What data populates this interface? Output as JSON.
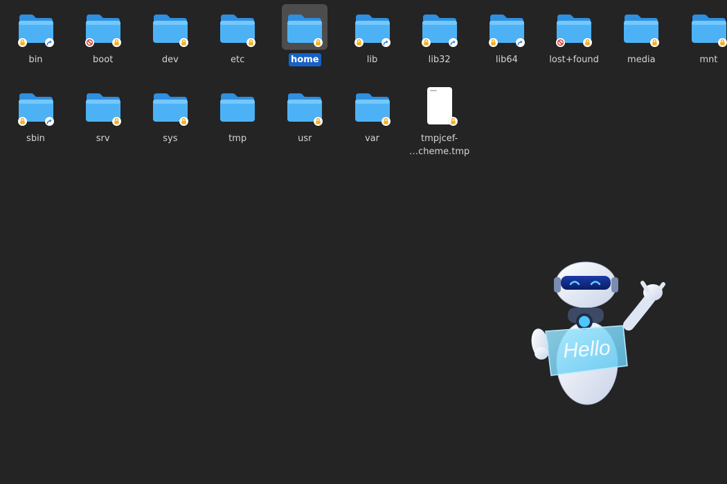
{
  "desktop": {
    "background": "#242424",
    "accent_selected": "#1761c7",
    "items": [
      {
        "label": "bin",
        "kind": "folder",
        "badges": [
          "lock",
          "symlink"
        ],
        "selected": false
      },
      {
        "label": "boot",
        "kind": "folder",
        "badges": [
          "no-access",
          "lock"
        ],
        "selected": false
      },
      {
        "label": "dev",
        "kind": "folder",
        "badges": [
          "lock"
        ],
        "selected": false
      },
      {
        "label": "etc",
        "kind": "folder",
        "badges": [
          "lock"
        ],
        "selected": false
      },
      {
        "label": "home",
        "kind": "folder",
        "badges": [
          "lock"
        ],
        "selected": true
      },
      {
        "label": "lib",
        "kind": "folder",
        "badges": [
          "lock",
          "symlink"
        ],
        "selected": false
      },
      {
        "label": "lib32",
        "kind": "folder",
        "badges": [
          "lock",
          "symlink"
        ],
        "selected": false
      },
      {
        "label": "lib64",
        "kind": "folder",
        "badges": [
          "lock",
          "symlink"
        ],
        "selected": false
      },
      {
        "label": "lost+found",
        "kind": "folder",
        "badges": [
          "no-access",
          "lock"
        ],
        "selected": false
      },
      {
        "label": "media",
        "kind": "folder",
        "badges": [
          "lock"
        ],
        "selected": false
      },
      {
        "label": "mnt",
        "kind": "folder",
        "badges": [
          "lock"
        ],
        "selected": false
      },
      {
        "label": "sbin",
        "kind": "folder",
        "badges": [
          "lock",
          "symlink"
        ],
        "selected": false
      },
      {
        "label": "srv",
        "kind": "folder",
        "badges": [
          "lock"
        ],
        "selected": false
      },
      {
        "label": "sys",
        "kind": "folder",
        "badges": [
          "lock"
        ],
        "selected": false
      },
      {
        "label": "tmp",
        "kind": "folder",
        "badges": [],
        "selected": false
      },
      {
        "label": "usr",
        "kind": "folder",
        "badges": [
          "lock"
        ],
        "selected": false
      },
      {
        "label": "var",
        "kind": "folder",
        "badges": [
          "lock"
        ],
        "selected": false
      },
      {
        "label": "tmpjcef-…cheme.tmp",
        "label_line1": "tmpjcef-",
        "label_line2": "…cheme.tmp",
        "kind": "file",
        "badges": [
          "lock"
        ],
        "selected": false
      }
    ]
  },
  "mascot": {
    "sign_text": "Hello",
    "icon": "robot-mascot-icon"
  }
}
